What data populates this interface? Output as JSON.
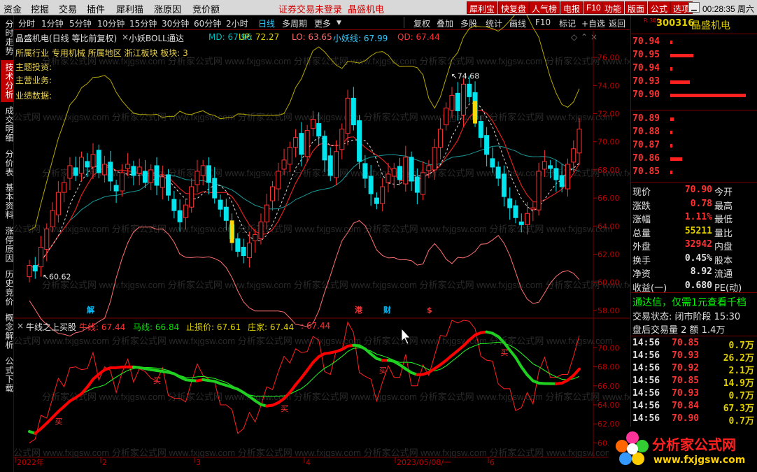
{
  "menubar": {
    "items": [
      "资金",
      "挖掘",
      "交易",
      "插件",
      "犀利猫",
      "涨原因",
      "竞价额"
    ],
    "notice": "证券交易未登录",
    "stock_title": "晶盛机电",
    "buttons": [
      "犀利宝",
      "快复盘",
      "人气榜",
      "电报",
      "F10",
      "功能",
      "版面",
      "公式",
      "选项"
    ],
    "clock": "00:28:35 周六"
  },
  "left_tabs": [
    "分时走势",
    "技术分析",
    "成交明细",
    "分价表",
    "基本资料",
    "涨停原因",
    "历史竞价",
    "概念解析",
    "公式下载"
  ],
  "toolbar": {
    "periods": [
      "分时",
      "1分钟",
      "5分钟",
      "10分钟",
      "15分钟",
      "30分钟",
      "60分钟",
      "2小时",
      "日线",
      "多周期",
      "更多"
    ],
    "active": "日线",
    "tools": [
      "复权",
      "叠加",
      "多股",
      "统计",
      "画线",
      "F10",
      "标记",
      "+自选",
      "返回"
    ]
  },
  "main_chart": {
    "name": "晶盛机电(日线 等比前复权)",
    "indicator": "小妖BOLL通达",
    "md": "MD: 67.96",
    "up": "UP: 72.27",
    "lo": "LO: 63.65",
    "xyline": "小妖线: 67.99",
    "qd": "QD: 67.44",
    "industry": "所属行业 专用机械 所属地区 浙江板块 板块: 3",
    "topic": "主题投资:",
    "business": "主营业务:",
    "performance": "业绩数据:",
    "high_label": "74.68",
    "low_label": "60.62",
    "price_axis": [
      "76.00",
      "74.00",
      "72.00",
      "70.00",
      "68.00",
      "66.00",
      "64.00",
      "62.00",
      "60.00",
      "58.00"
    ],
    "event_marks": [
      "解",
      "港",
      "财",
      "$"
    ]
  },
  "sub_chart": {
    "name": "牛线之上买股",
    "nx": "牛线: 67.44",
    "mx": "马线: 66.84",
    "zs": "止损价: 67.61",
    "zj": "庄家: 67.44",
    "extra": ": 67.44",
    "axis": [
      "70.00",
      "68.00",
      "66.00",
      "64.00",
      "62.00",
      "60.00"
    ],
    "signal_label": "买"
  },
  "time_axis": {
    "labels": [
      "2022年",
      "2",
      "3",
      "4",
      "2023/05/08/一",
      "6"
    ]
  },
  "right_panel": {
    "code_prefix": "R 300",
    "code": "300316",
    "name": "晶盛机电",
    "asks": [
      {
        "price": "70.94",
        "bar": 0.03
      },
      {
        "price": "70.95",
        "bar": 0.31
      },
      {
        "price": "70.94",
        "bar": 0.03
      },
      {
        "price": "70.93",
        "bar": 0.26
      },
      {
        "price": "70.90",
        "bar": 1.0
      }
    ],
    "bids": [
      {
        "price": "70.89",
        "bar": 0.05
      },
      {
        "price": "70.88",
        "bar": 0.03
      },
      {
        "price": "70.87",
        "bar": 0.03
      },
      {
        "price": "70.86",
        "bar": 0.16
      },
      {
        "price": "70.85",
        "bar": 0.03
      }
    ],
    "quote": [
      {
        "l1": "现价",
        "v1": "70.90",
        "l2": "今开"
      },
      {
        "l1": "涨跌",
        "v1": "0.78",
        "l2": "最高"
      },
      {
        "l1": "涨幅",
        "v1": "1.11%",
        "l2": "最低"
      },
      {
        "l1": "总量",
        "v1": "55211",
        "l2": "量比"
      },
      {
        "l1": "外盘",
        "v1": "32942",
        "l2": "内盘"
      },
      {
        "l1": "换手",
        "v1": "0.45%",
        "l2": "股本"
      },
      {
        "l1": "净资",
        "v1": "8.92",
        "l2": "流通"
      },
      {
        "l1": "收益(一)",
        "v1": "0.680",
        "l2": "PE(动)"
      }
    ],
    "ad": "通达信，仅需1元查看千档",
    "trade_state": "交易状态: 闭市阶段 15:30",
    "after_volume": "盘后交易量 2 额 1.4万",
    "ticks": [
      {
        "t": "14:56",
        "p": "70.85",
        "v": "0.7万"
      },
      {
        "t": "14:56",
        "p": "70.93",
        "v": "26.2万"
      },
      {
        "t": "14:56",
        "p": "70.92",
        "v": "2.1万"
      },
      {
        "t": "14:56",
        "p": "70.85",
        "v": "14.9万"
      },
      {
        "t": "14:56",
        "p": "70.93",
        "v": "0.7万"
      },
      {
        "t": "14:56",
        "p": "70.84",
        "v": "67.3万"
      },
      {
        "t": "14:56",
        "p": "70.90",
        "v": "0.7万"
      },
      {
        "t": "14:57",
        "p": "70.83",
        "v": "2.8万"
      }
    ]
  },
  "watermark": "分析家公式网 www.fxjgsw.com",
  "logo": {
    "title": "分析家公式网",
    "url": "www.fxjgsw.com"
  },
  "colors": {
    "up": "#ff3232",
    "down": "#00e5ee",
    "ma": "#e0d000",
    "signal": "#ff0000",
    "horse": "#00e000",
    "bg": "#000000"
  },
  "chart_data": {
    "type": "candlestick",
    "title": "晶盛机电(日线 等比前复权)",
    "ylim": [
      57.5,
      77
    ],
    "closes": [
      61.2,
      60.8,
      62.5,
      63.8,
      65.1,
      66.4,
      67.1,
      68.3,
      67.6,
      68.9,
      68.2,
      69.1,
      67.8,
      68.4,
      67.2,
      66.5,
      67.8,
      68.4,
      67.6,
      68.2,
      67.1,
      68.0,
      66.9,
      67.5,
      66.2,
      65.1,
      64.3,
      65.5,
      66.8,
      67.9,
      68.3,
      67.1,
      66.0,
      65.2,
      64.4,
      63.1,
      62.2,
      61.9,
      62.8,
      63.4,
      64.3,
      65.5,
      66.8,
      67.9,
      68.7,
      69.6,
      70.3,
      69.1,
      70.8,
      71.6,
      70.4,
      68.7,
      67.6,
      69.3,
      70.9,
      73.1,
      71.2,
      68.6,
      67.4,
      66.3,
      65.6,
      66.8,
      67.7,
      68.1,
      67.3,
      68.9,
      67.2,
      66.4,
      67.8,
      68.3,
      69.6,
      70.9,
      72.4,
      73.3,
      72.2,
      74.1,
      73.2,
      71.6,
      70.3,
      69.1,
      68.2,
      67.4,
      66.1,
      65.3,
      64.6,
      64.1,
      64.9,
      65.3,
      67.9,
      68.6,
      68.1,
      67.3,
      66.8,
      68.4,
      69.5,
      70.9
    ]
  }
}
